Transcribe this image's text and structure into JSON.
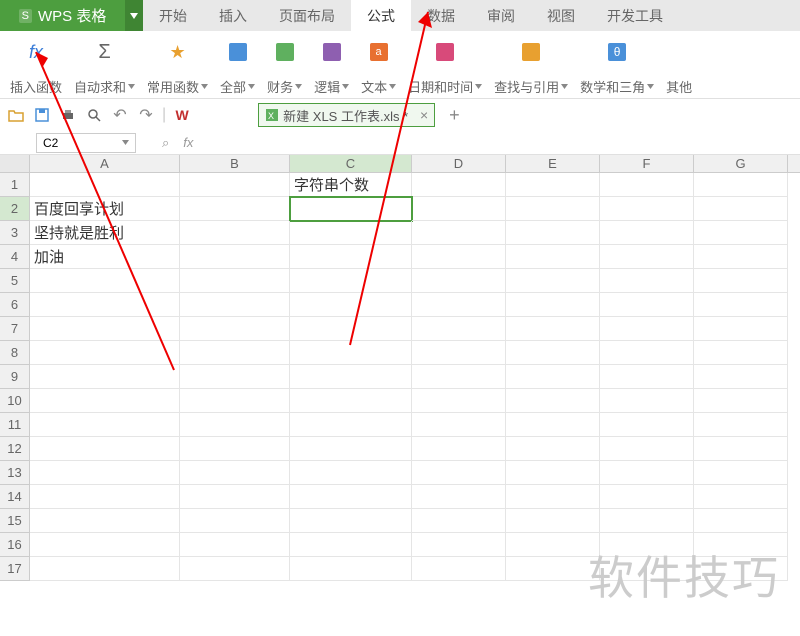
{
  "app": {
    "name": "WPS 表格",
    "badge": "S"
  },
  "tabs": [
    "开始",
    "插入",
    "页面布局",
    "公式",
    "数据",
    "审阅",
    "视图",
    "开发工具"
  ],
  "active_tab": 3,
  "ribbon": [
    {
      "label": "插入函数",
      "icon": "fx",
      "dropdown": false
    },
    {
      "label": "自动求和",
      "icon": "sigma",
      "dropdown": true
    },
    {
      "label": "常用函数",
      "icon": "star",
      "dropdown": true
    },
    {
      "label": "全部",
      "icon": "box-blue",
      "dropdown": true
    },
    {
      "label": "财务",
      "icon": "box-green",
      "dropdown": true
    },
    {
      "label": "逻辑",
      "icon": "box-purple",
      "dropdown": true
    },
    {
      "label": "文本",
      "icon": "box-orange",
      "dropdown": true
    },
    {
      "label": "日期和时间",
      "icon": "box-teal",
      "dropdown": true
    },
    {
      "label": "查找与引用",
      "icon": "box-orange2",
      "dropdown": true
    },
    {
      "label": "数学和三角",
      "icon": "box-blue2",
      "dropdown": true
    },
    {
      "label": "其他",
      "icon": "",
      "dropdown": false
    }
  ],
  "doc": {
    "title": "新建 XLS 工作表.xls *"
  },
  "namebox": "C2",
  "fx_icons": {
    "search": "⌕",
    "fx": "fx"
  },
  "columns": [
    "A",
    "B",
    "C",
    "D",
    "E",
    "F",
    "G"
  ],
  "rows": [
    1,
    2,
    3,
    4,
    5,
    6,
    7,
    8,
    9,
    10,
    11,
    12,
    13,
    14,
    15,
    16,
    17
  ],
  "cells": {
    "C1": "字符串个数",
    "A2": "百度回享计划",
    "A3": "坚持就是胜利",
    "A4": "加油"
  },
  "selected_cell": "C2",
  "watermark": "软件技巧"
}
